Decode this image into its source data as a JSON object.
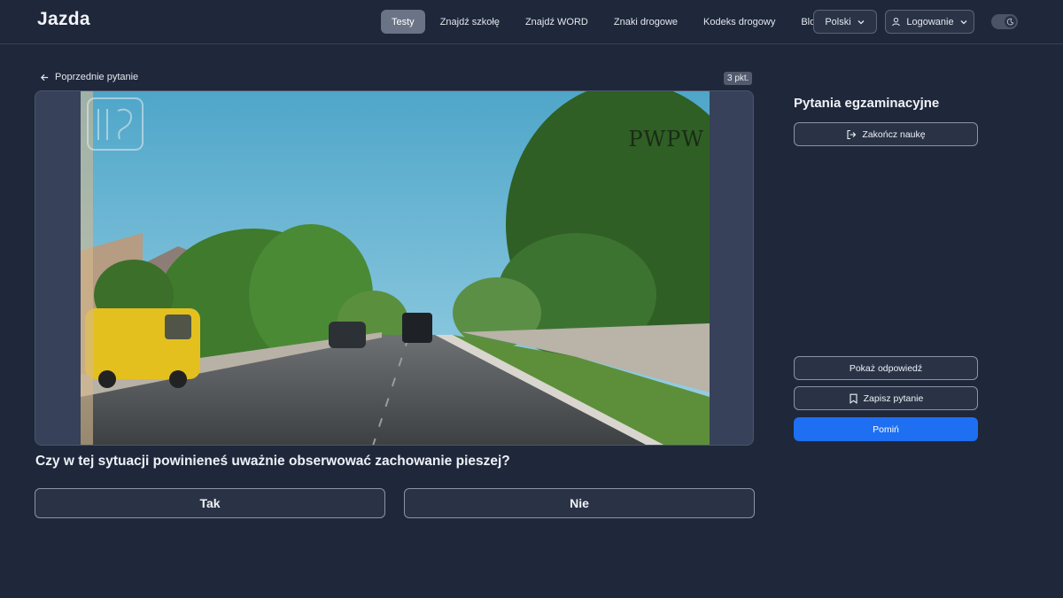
{
  "header": {
    "logo": "Jazda",
    "nav": [
      {
        "label": "Testy",
        "active": true
      },
      {
        "label": "Znajdź szkołę",
        "active": false
      },
      {
        "label": "Znajdź WORD",
        "active": false
      },
      {
        "label": "Znaki drogowe",
        "active": false
      },
      {
        "label": "Kodeks drogowy",
        "active": false
      },
      {
        "label": "Blog",
        "active": false
      }
    ],
    "language": "Polski",
    "login": "Logowanie"
  },
  "question_panel": {
    "prev_label": "Poprzednie pytanie",
    "points": "3 pkt.",
    "watermark_right": "PWPW",
    "question": "Czy w tej sytuacji powinieneś uważnie obserwować zachowanie pieszej?",
    "answers": [
      "Tak",
      "Nie"
    ]
  },
  "sidebar": {
    "title": "Pytania egzaminacyjne",
    "finish_label": "Zakończ naukę",
    "show_answer_label": "Pokaż odpowiedź",
    "save_label": "Zapisz pytanie",
    "skip_label": "Pomiń"
  },
  "colors": {
    "background": "#1f273a",
    "accent": "#1e6ff2",
    "nav_active": "#6b7487"
  }
}
